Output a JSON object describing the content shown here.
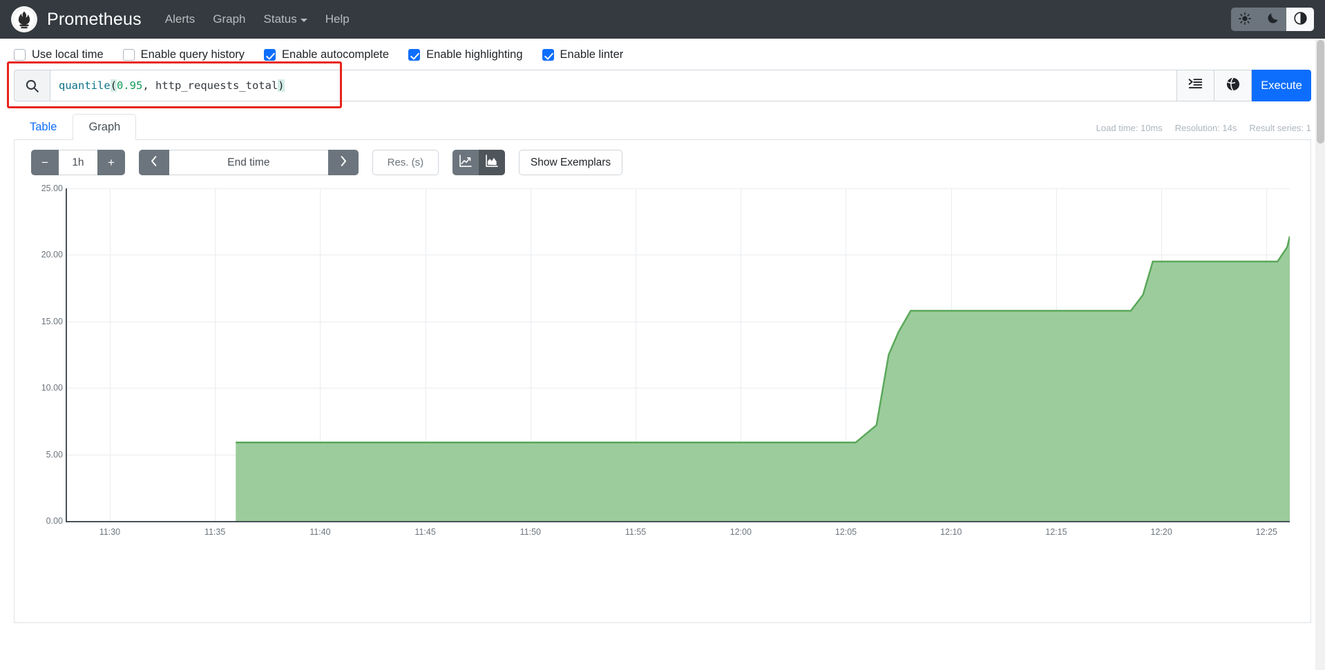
{
  "navbar": {
    "brand": "Prometheus",
    "logo_icon": "prometheus-torch-icon",
    "links": [
      {
        "label": "Alerts",
        "name": "alerts"
      },
      {
        "label": "Graph",
        "name": "graph"
      },
      {
        "label": "Status",
        "name": "status",
        "dropdown": true
      },
      {
        "label": "Help",
        "name": "help"
      }
    ],
    "theme_buttons": [
      {
        "icon": "sun-icon",
        "name": "theme-light",
        "active": false
      },
      {
        "icon": "moon-icon",
        "name": "theme-dark",
        "active": false
      },
      {
        "icon": "contrast-half-circle-icon",
        "name": "theme-auto",
        "active": true
      }
    ]
  },
  "options": [
    {
      "label": "Use local time",
      "checked": false
    },
    {
      "label": "Enable query history",
      "checked": false
    },
    {
      "label": "Enable autocomplete",
      "checked": true
    },
    {
      "label": "Enable highlighting",
      "checked": true
    },
    {
      "label": "Enable linter",
      "checked": true
    }
  ],
  "query": {
    "search_icon": "magnifier-icon",
    "expression": "quantile(0.95, http_requests_total)",
    "tokens": {
      "fn": "quantile",
      "open_paren": "(",
      "number": "0.95",
      "rest": ", http_requests_total",
      "close_paren": ")"
    },
    "format_button_icon": "format-indent-icon",
    "explorer_button_icon": "globe-metrics-icon",
    "execute_label": "Execute"
  },
  "tabs": [
    {
      "label": "Table",
      "active": false
    },
    {
      "label": "Graph",
      "active": true
    }
  ],
  "meta": {
    "load_time": "Load time: 10ms",
    "resolution": "Resolution: 14s",
    "result_series": "Result series: 1"
  },
  "graph_toolbar": {
    "decrease_range": "−",
    "range_value": "1h",
    "increase_range": "+",
    "prev_icon": "chevron-left-icon",
    "end_time_placeholder": "End time",
    "next_icon": "chevron-right-icon",
    "resolution_placeholder": "Res. (s)",
    "chart_types": [
      {
        "icon": "line-chart-icon",
        "name": "line-chart",
        "active": false
      },
      {
        "icon": "stacked-area-chart-icon",
        "name": "stacked-chart",
        "active": true
      }
    ],
    "show_exemplars": "Show Exemplars"
  },
  "colors": {
    "accent": "#0d6efd",
    "navbar_bg": "#343a40",
    "series_fill": "#9ccc9c",
    "series_stroke": "#5aa85a",
    "annotation_box": "#e8231a"
  },
  "chart_data": {
    "type": "area",
    "title": "",
    "xlabel": "",
    "ylabel": "",
    "ylim": [
      0,
      25
    ],
    "yticks": [
      0.0,
      5.0,
      10.0,
      15.0,
      20.0,
      25.0
    ],
    "ytick_labels": [
      "0.00",
      "5.00",
      "10.00",
      "15.00",
      "20.00",
      "25.00"
    ],
    "xticks": [
      "11:30",
      "11:35",
      "11:40",
      "11:45",
      "11:50",
      "11:55",
      "12:00",
      "12:05",
      "12:10",
      "12:15",
      "12:20",
      "12:25"
    ],
    "grid": true,
    "legend": "none",
    "series": [
      {
        "name": "quantile(0.95, http_requests_total)",
        "fill": "#9ccc9c",
        "stroke": "#5aa85a",
        "step": true,
        "points": [
          {
            "x": "11:36",
            "y": 5.9
          },
          {
            "x": "12:04",
            "y": 5.9
          },
          {
            "x": "12:05",
            "y": 7.2
          },
          {
            "x": "12:05:30",
            "y": 12.5
          },
          {
            "x": "12:06",
            "y": 14.2
          },
          {
            "x": "12:06:30",
            "y": 15.8
          },
          {
            "x": "12:17",
            "y": 15.8
          },
          {
            "x": "12:17:30",
            "y": 17.0
          },
          {
            "x": "12:18",
            "y": 19.5
          },
          {
            "x": "12:24",
            "y": 19.5
          },
          {
            "x": "12:24:30",
            "y": 20.6
          },
          {
            "x": "12:25",
            "y": 21.4
          },
          {
            "x": "12:27",
            "y": 21.4
          }
        ]
      }
    ]
  }
}
